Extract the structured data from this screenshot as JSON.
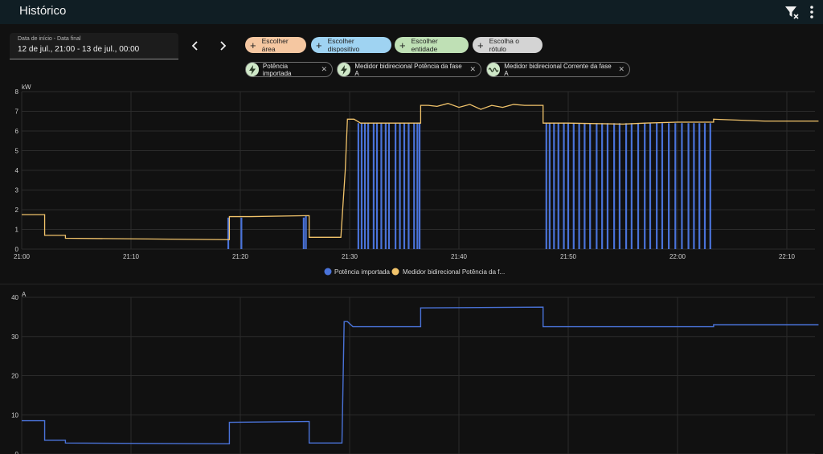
{
  "header": {
    "title": "Histórico"
  },
  "date_range": {
    "label": "Data de início - Data final",
    "value": "12 de jul., 21:00 - 13 de jul., 00:00"
  },
  "filters": [
    {
      "label": "Escolher área",
      "bg": "#f5c7a1"
    },
    {
      "label": "Escolher dispositivo",
      "bg": "#9fd3f2"
    },
    {
      "label": "Escolher entidade",
      "bg": "#bfe0b5"
    },
    {
      "label": "Escolha o rótulo",
      "bg": "#d4d4d4"
    }
  ],
  "entities": [
    {
      "label": "Potência importada",
      "icon": "flash-icon"
    },
    {
      "label": "Medidor bidirecional Potência da fase A",
      "icon": "flash-icon"
    },
    {
      "label": "Medidor bidirecional Corrente da fase A",
      "icon": "sine-wave-icon"
    }
  ],
  "colors": {
    "blue": "#4a73d9",
    "orange": "#f2c46b",
    "grid": "#2c2c2c"
  },
  "chart_data": [
    {
      "type": "line",
      "ylabel": "kW",
      "ylim": [
        0,
        8
      ],
      "yticks": [
        "0",
        "1",
        "2",
        "3",
        "4",
        "5",
        "6",
        "7",
        "8"
      ],
      "xticks": [
        "21:00",
        "21:10",
        "21:20",
        "21:30",
        "21:40",
        "21:50",
        "22:00",
        "22:10"
      ],
      "legend": [
        "Potência importada",
        "Medidor bidirecional Potência da f..."
      ],
      "series": [
        {
          "name": "Medidor bidirecional Potência da fase A",
          "color": "#f2c46b",
          "x": [
            0,
            2.1,
            2.1,
            4.0,
            4.0,
            19.0,
            19.0,
            20.5,
            21.0,
            26.3,
            26.3,
            28.0,
            29.2,
            29.6,
            29.8,
            30.4,
            31.0,
            36.5,
            36.5,
            37.2,
            38.0,
            39.0,
            40.0,
            41.0,
            42.0,
            43.0,
            44.0,
            45.0,
            46.0,
            47.7,
            47.7,
            50.0,
            55.0,
            57.0,
            60.0,
            63.3,
            63.3,
            68.0,
            72.9
          ],
          "y": [
            1.75,
            1.75,
            0.7,
            0.7,
            0.55,
            0.48,
            1.65,
            1.65,
            1.65,
            1.7,
            0.6,
            0.6,
            0.6,
            4.0,
            6.6,
            6.6,
            6.4,
            6.4,
            7.3,
            7.3,
            7.25,
            7.4,
            7.2,
            7.35,
            7.1,
            7.3,
            7.2,
            7.35,
            7.3,
            7.3,
            6.4,
            6.4,
            6.35,
            6.4,
            6.45,
            6.45,
            6.6,
            6.5,
            6.5
          ]
        },
        {
          "name": "Potência importada",
          "color": "#4a73d9",
          "spikes": [
            {
              "x": 18.9,
              "y": 1.6
            },
            {
              "x": 20.1,
              "y": 1.6
            },
            {
              "x": 25.8,
              "y": 1.6
            },
            {
              "x": 26.0,
              "y": 1.7
            },
            {
              "x": 30.8,
              "y": 6.4
            },
            {
              "x": 31.1,
              "y": 6.4
            },
            {
              "x": 31.4,
              "y": 6.4
            },
            {
              "x": 31.7,
              "y": 6.4
            },
            {
              "x": 32.2,
              "y": 6.4
            },
            {
              "x": 32.5,
              "y": 6.4
            },
            {
              "x": 32.9,
              "y": 6.4
            },
            {
              "x": 33.3,
              "y": 6.4
            },
            {
              "x": 33.6,
              "y": 6.4
            },
            {
              "x": 34.2,
              "y": 6.4
            },
            {
              "x": 34.6,
              "y": 6.4
            },
            {
              "x": 35.0,
              "y": 6.4
            },
            {
              "x": 35.4,
              "y": 6.4
            },
            {
              "x": 35.9,
              "y": 6.4
            },
            {
              "x": 36.2,
              "y": 6.4
            },
            {
              "x": 36.4,
              "y": 6.4
            },
            {
              "x": 48.0,
              "y": 6.4
            },
            {
              "x": 48.3,
              "y": 6.4
            },
            {
              "x": 48.7,
              "y": 6.4
            },
            {
              "x": 49.1,
              "y": 6.4
            },
            {
              "x": 49.6,
              "y": 6.4
            },
            {
              "x": 50.0,
              "y": 6.4
            },
            {
              "x": 50.5,
              "y": 6.4
            },
            {
              "x": 51.0,
              "y": 6.4
            },
            {
              "x": 51.5,
              "y": 6.4
            },
            {
              "x": 52.0,
              "y": 6.4
            },
            {
              "x": 52.6,
              "y": 6.4
            },
            {
              "x": 53.1,
              "y": 6.4
            },
            {
              "x": 53.6,
              "y": 6.4
            },
            {
              "x": 54.2,
              "y": 6.4
            },
            {
              "x": 54.7,
              "y": 6.4
            },
            {
              "x": 55.3,
              "y": 6.4
            },
            {
              "x": 55.8,
              "y": 6.4
            },
            {
              "x": 56.4,
              "y": 6.4
            },
            {
              "x": 57.0,
              "y": 6.4
            },
            {
              "x": 57.5,
              "y": 6.4
            },
            {
              "x": 58.1,
              "y": 6.4
            },
            {
              "x": 58.6,
              "y": 6.4
            },
            {
              "x": 59.2,
              "y": 6.4
            },
            {
              "x": 59.8,
              "y": 6.4
            },
            {
              "x": 60.4,
              "y": 6.4
            },
            {
              "x": 61.0,
              "y": 6.4
            },
            {
              "x": 61.5,
              "y": 6.4
            },
            {
              "x": 62.0,
              "y": 6.4
            },
            {
              "x": 62.5,
              "y": 6.4
            },
            {
              "x": 63.0,
              "y": 6.4
            }
          ]
        }
      ]
    },
    {
      "type": "line",
      "ylabel": "A",
      "ylim": [
        0,
        40
      ],
      "yticks": [
        "0",
        "10",
        "20",
        "30",
        "40"
      ],
      "series": [
        {
          "name": "Medidor bidirecional Corrente da fase A",
          "color": "#4a73d9",
          "x": [
            0,
            2.1,
            2.1,
            4.0,
            4.0,
            19.0,
            19.0,
            26.3,
            26.3,
            29.3,
            29.5,
            29.8,
            30.3,
            30.5,
            36.5,
            36.5,
            47.7,
            47.7,
            63.3,
            63.3,
            72.9
          ],
          "y": [
            8.5,
            8.5,
            3.5,
            3.5,
            2.8,
            2.6,
            8.1,
            8.3,
            2.8,
            2.8,
            33.8,
            33.8,
            32.5,
            32.5,
            32.5,
            37.3,
            37.5,
            32.5,
            32.5,
            33.0,
            33.0
          ]
        }
      ]
    }
  ]
}
